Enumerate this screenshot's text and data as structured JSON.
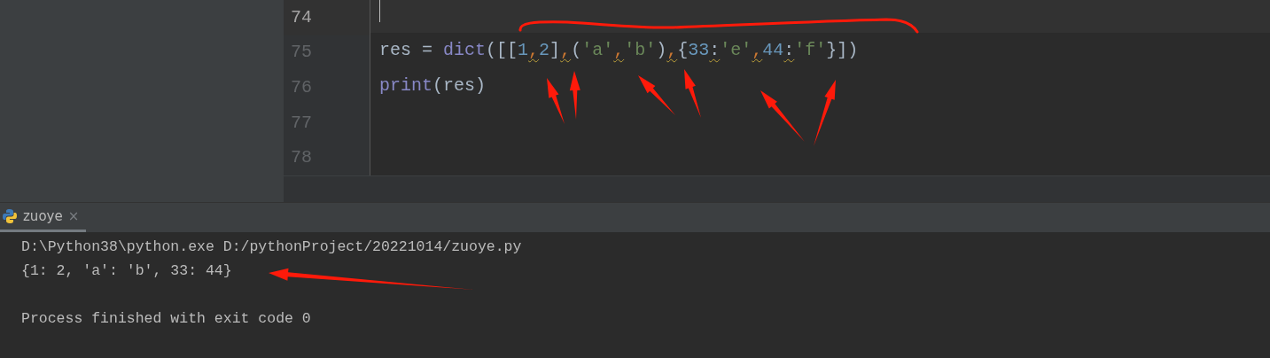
{
  "editor": {
    "lines": [
      {
        "number": "74",
        "current": true
      },
      {
        "number": "75",
        "current": false,
        "tokens": [
          {
            "kind": "plain",
            "text": "res = "
          },
          {
            "kind": "builtin",
            "text": "dict"
          },
          {
            "kind": "plain",
            "text": "([["
          },
          {
            "kind": "number",
            "text": "1"
          },
          {
            "kind": "comma",
            "text": ",",
            "warn": true
          },
          {
            "kind": "number",
            "text": "2"
          },
          {
            "kind": "plain",
            "text": "]"
          },
          {
            "kind": "comma",
            "text": ",",
            "warn": true
          },
          {
            "kind": "plain",
            "text": "("
          },
          {
            "kind": "string",
            "text": "'a'"
          },
          {
            "kind": "comma",
            "text": ",",
            "warn": true
          },
          {
            "kind": "string",
            "text": "'b'"
          },
          {
            "kind": "plain",
            "text": ")"
          },
          {
            "kind": "comma",
            "text": ",",
            "warn": true
          },
          {
            "kind": "plain",
            "text": "{"
          },
          {
            "kind": "number",
            "text": "33"
          },
          {
            "kind": "plain",
            "text": ":",
            "warn": true
          },
          {
            "kind": "string",
            "text": "'e'"
          },
          {
            "kind": "comma",
            "text": ",",
            "warn": true
          },
          {
            "kind": "number",
            "text": "44"
          },
          {
            "kind": "plain",
            "text": ":",
            "warn": true
          },
          {
            "kind": "string",
            "text": "'f'"
          },
          {
            "kind": "plain",
            "text": "}])"
          }
        ]
      },
      {
        "number": "76",
        "current": false,
        "tokens": [
          {
            "kind": "builtin",
            "text": "print"
          },
          {
            "kind": "plain",
            "text": "(res)"
          }
        ]
      },
      {
        "number": "77",
        "current": false
      },
      {
        "number": "78",
        "current": false
      }
    ]
  },
  "run_panel": {
    "tabs": [
      {
        "label": "zuoye",
        "selected": true,
        "close": "×"
      }
    ],
    "console": {
      "command": "D:\\Python38\\python.exe D:/pythonProject/20221014/zuoye.py",
      "output": "{1: 2, 'a': 'b', 33: 44}",
      "exit_message": "Process finished with exit code 0"
    }
  }
}
